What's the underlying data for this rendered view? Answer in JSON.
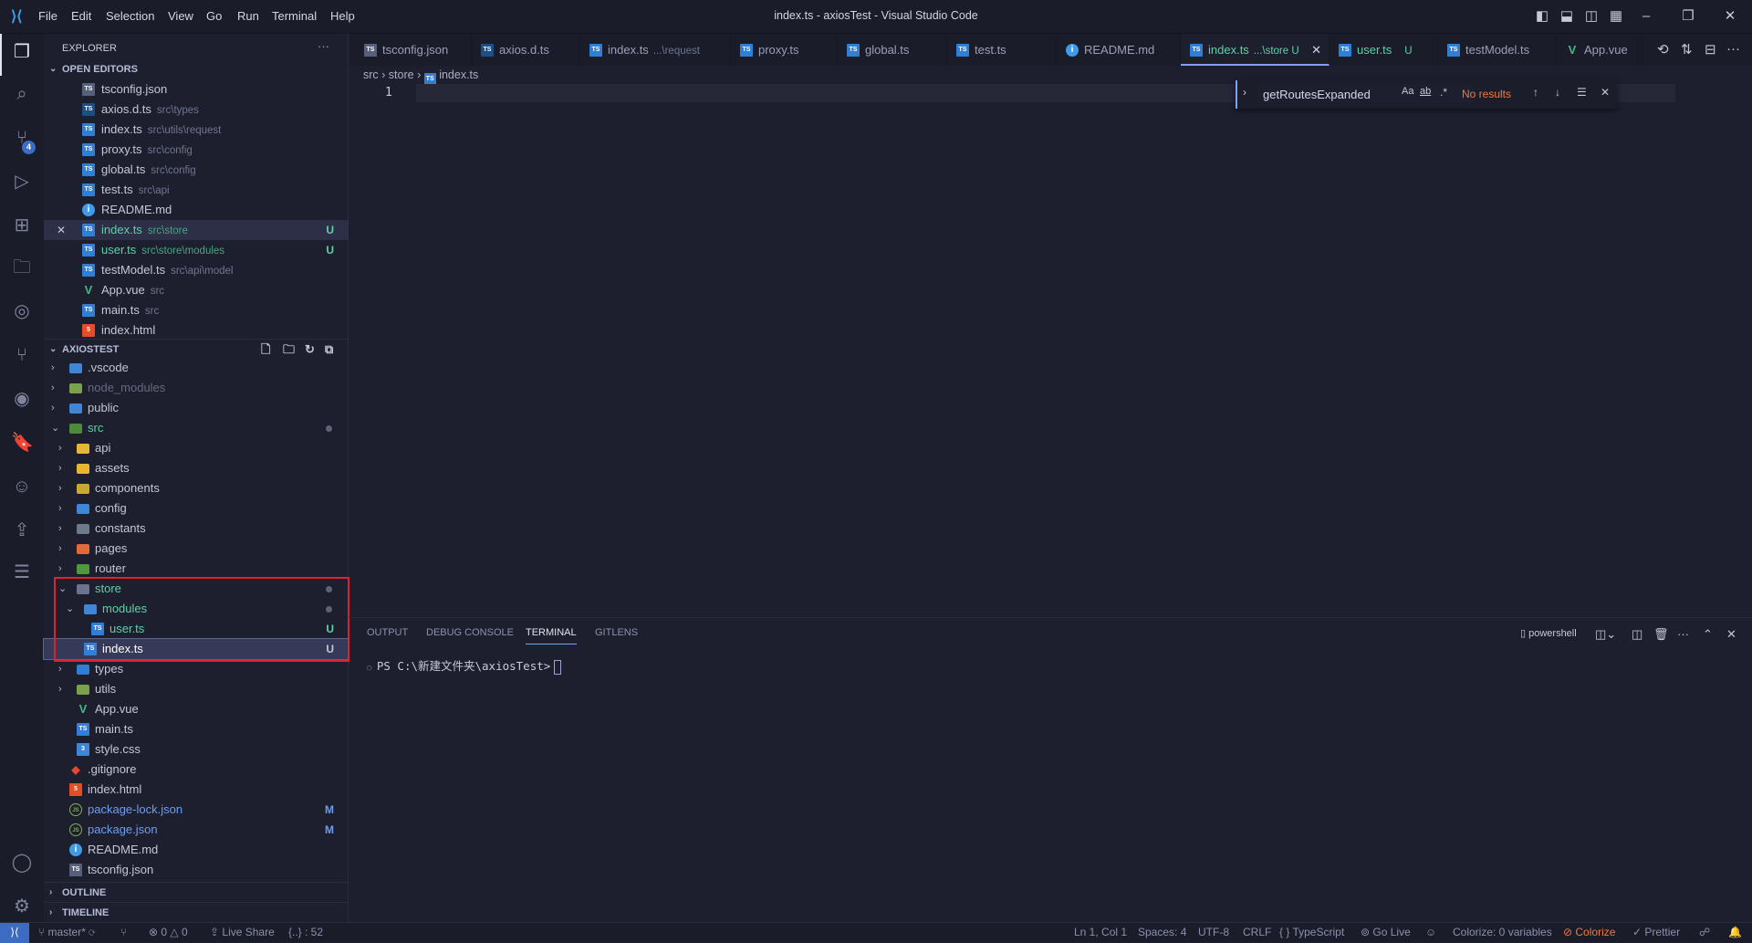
{
  "titlebar": {
    "menu": [
      "File",
      "Edit",
      "Selection",
      "View",
      "Go",
      "Run",
      "Terminal",
      "Help"
    ],
    "title": "index.ts - axiosTest - Visual Studio Code"
  },
  "activity": {
    "scm_badge": "4",
    "icons": [
      "files-icon",
      "search-icon",
      "source-control-icon",
      "run-debug-icon",
      "extensions-icon",
      "remote-explorer-icon",
      "gitlens-icon",
      "git-graph-icon",
      "edge-devtools-icon",
      "bookmarks-icon",
      "copilot-icon",
      "live-share-icon",
      "todo-list-icon",
      "account-icon",
      "settings-gear-icon"
    ]
  },
  "sidebar": {
    "title": "EXPLORER",
    "more": "···",
    "open_editors_header": "OPEN EDITORS",
    "open_editors": [
      {
        "name": "tsconfig.json",
        "desc": "",
        "icon": "tsconfig"
      },
      {
        "name": "axios.d.ts",
        "desc": "src\\types",
        "icon": "dts"
      },
      {
        "name": "index.ts",
        "desc": "src\\utils\\request",
        "icon": "ts"
      },
      {
        "name": "proxy.ts",
        "desc": "src\\config",
        "icon": "ts"
      },
      {
        "name": "global.ts",
        "desc": "src\\config",
        "icon": "ts"
      },
      {
        "name": "test.ts",
        "desc": "src\\api",
        "icon": "ts"
      },
      {
        "name": "README.md",
        "desc": "",
        "icon": "info"
      },
      {
        "name": "index.ts",
        "desc": "src\\store",
        "icon": "ts",
        "badge": "U",
        "status": "untracked",
        "selected": true
      },
      {
        "name": "user.ts",
        "desc": "src\\store\\modules",
        "icon": "ts",
        "badge": "U",
        "status": "untracked"
      },
      {
        "name": "testModel.ts",
        "desc": "src\\api\\model",
        "icon": "ts"
      },
      {
        "name": "App.vue",
        "desc": "src",
        "icon": "vue"
      },
      {
        "name": "main.ts",
        "desc": "src",
        "icon": "ts"
      },
      {
        "name": "index.html",
        "desc": "",
        "icon": "html"
      }
    ],
    "project_header": "AXIOSTEST",
    "tree": [
      {
        "name": ".vscode",
        "depth": 0,
        "folder": true,
        "open": false,
        "icon": "folder-vscode"
      },
      {
        "name": "node_modules",
        "depth": 0,
        "folder": true,
        "open": false,
        "icon": "folder-node",
        "status": "ignored"
      },
      {
        "name": "public",
        "depth": 0,
        "folder": true,
        "open": false,
        "icon": "folder-public"
      },
      {
        "name": "src",
        "depth": 0,
        "folder": true,
        "open": true,
        "icon": "folder-src",
        "status": "untracked",
        "dot": true
      },
      {
        "name": "api",
        "depth": 1,
        "folder": true,
        "open": false,
        "icon": "folder-api"
      },
      {
        "name": "assets",
        "depth": 1,
        "folder": true,
        "open": false,
        "icon": "folder-assets"
      },
      {
        "name": "components",
        "depth": 1,
        "folder": true,
        "open": false,
        "icon": "folder-components"
      },
      {
        "name": "config",
        "depth": 1,
        "folder": true,
        "open": false,
        "icon": "folder-config"
      },
      {
        "name": "constants",
        "depth": 1,
        "folder": true,
        "open": false,
        "icon": "folder-constants"
      },
      {
        "name": "pages",
        "depth": 1,
        "folder": true,
        "open": false,
        "icon": "folder-pages"
      },
      {
        "name": "router",
        "depth": 1,
        "folder": true,
        "open": false,
        "icon": "folder-router"
      },
      {
        "name": "store",
        "depth": 1,
        "folder": true,
        "open": true,
        "icon": "folder-store",
        "status": "untracked",
        "dot": true
      },
      {
        "name": "modules",
        "depth": 2,
        "folder": true,
        "open": true,
        "icon": "folder-modules",
        "status": "untracked",
        "dot": true
      },
      {
        "name": "user.ts",
        "depth": 3,
        "icon": "ts",
        "badge": "U",
        "status": "untracked"
      },
      {
        "name": "index.ts",
        "depth": 2,
        "icon": "ts",
        "badge": "U",
        "status": "focused"
      },
      {
        "name": "types",
        "depth": 1,
        "folder": true,
        "open": false,
        "icon": "folder-types"
      },
      {
        "name": "utils",
        "depth": 1,
        "folder": true,
        "open": false,
        "icon": "folder-utils"
      },
      {
        "name": "App.vue",
        "depth": 1,
        "icon": "vue"
      },
      {
        "name": "main.ts",
        "depth": 1,
        "icon": "ts"
      },
      {
        "name": "style.css",
        "depth": 1,
        "icon": "css"
      },
      {
        "name": ".gitignore",
        "depth": 0,
        "icon": "git"
      },
      {
        "name": "index.html",
        "depth": 0,
        "icon": "html"
      },
      {
        "name": "package-lock.json",
        "depth": 0,
        "icon": "node",
        "badge": "M",
        "status": "modified"
      },
      {
        "name": "package.json",
        "depth": 0,
        "icon": "node",
        "badge": "M",
        "status": "modified"
      },
      {
        "name": "README.md",
        "depth": 0,
        "icon": "info"
      },
      {
        "name": "tsconfig.json",
        "depth": 0,
        "icon": "tsconfig"
      }
    ],
    "outline_header": "OUTLINE",
    "timeline_header": "TIMELINE"
  },
  "tabs": [
    {
      "name": "tsconfig.json",
      "desc": "",
      "icon": "tsconfig"
    },
    {
      "name": "axios.d.ts",
      "desc": "",
      "icon": "dts"
    },
    {
      "name": "index.ts",
      "desc": "...\\request",
      "icon": "ts"
    },
    {
      "name": "proxy.ts",
      "desc": "",
      "icon": "ts"
    },
    {
      "name": "global.ts",
      "desc": "",
      "icon": "ts"
    },
    {
      "name": "test.ts",
      "desc": "",
      "icon": "ts"
    },
    {
      "name": "README.md",
      "desc": "",
      "icon": "info"
    },
    {
      "name": "index.ts",
      "desc": "...\\store U",
      "icon": "ts",
      "active": true
    },
    {
      "name": "user.ts",
      "desc": "U",
      "icon": "ts",
      "status": "untracked"
    },
    {
      "name": "testModel.ts",
      "desc": "",
      "icon": "ts"
    },
    {
      "name": "App.vue",
      "desc": "",
      "icon": "vue"
    }
  ],
  "breadcrumb": [
    "src",
    "store",
    "index.ts"
  ],
  "editor": {
    "line_numbers": [
      "1"
    ]
  },
  "find": {
    "value": "getRoutesExpanded",
    "match_case": "Aa",
    "whole_word": "ab",
    "regex": ".*",
    "result": "No results"
  },
  "panel": {
    "tabs": [
      "OUTPUT",
      "DEBUG CONSOLE",
      "TERMINAL",
      "GITLENS"
    ],
    "active_tab": "TERMINAL",
    "shell": "powershell",
    "prompt": "PS C:\\新建文件夹\\axiosTest>"
  },
  "status": {
    "branch": "master*",
    "problems_errors": "0",
    "problems_warnings": "0",
    "live_share": "Live Share",
    "bracket": "{..} : 52",
    "position": "Ln 1, Col 1",
    "spaces": "Spaces: 4",
    "encoding": "UTF-8",
    "eol": "CRLF",
    "language": "TypeScript",
    "go_live": "Go Live",
    "colorize_vars": "Colorize: 0 variables",
    "colorize": "Colorize",
    "prettier": "Prettier"
  },
  "colors": {
    "accent": "#7aa2f7",
    "untracked": "#5fd0a6",
    "modified": "#6d9df0",
    "error_text": "#f0793f",
    "remote": "#3d6bc4",
    "highlight_box": "#e0202a"
  }
}
